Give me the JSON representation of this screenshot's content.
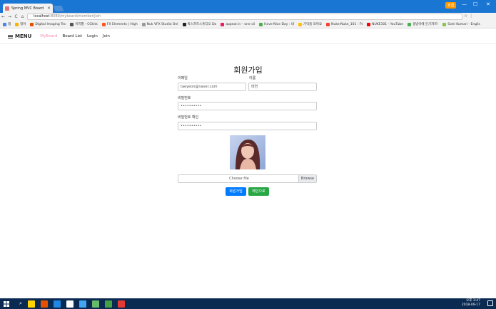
{
  "browser": {
    "tab_title": "Spring MVC Board",
    "tab_close": "×",
    "url_host": "localhost",
    "url_path": ":8080/myboard/member/join",
    "window_controls": [
      "—",
      "☐",
      "✕"
    ],
    "profile_label": "죠셉",
    "nav_icons": [
      "←",
      "→",
      "C",
      "⌂"
    ],
    "addr_icons": "☆ ⋮",
    "bookmarks": [
      {
        "label": "앱",
        "color": "#4285f4"
      },
      {
        "label": "정아",
        "color": "#f4b400"
      },
      {
        "label": "Digital Imaging Tec",
        "color": "#e65100"
      },
      {
        "label": "이지툴 - CGlink",
        "color": "#555555"
      },
      {
        "label": "FX Elements | High",
        "color": "#ff5722"
      },
      {
        "label": "Nuk VFX Studio Onl",
        "color": "#999999"
      },
      {
        "label": "퀵스프트스튜디오 Do",
        "color": "#222222"
      },
      {
        "label": "appear.in – one cli",
        "color": "#e91e63"
      },
      {
        "label": "Have Nice Day : 네",
        "color": "#4caf50"
      },
      {
        "label": "기억을 쪼아요",
        "color": "#ffc107"
      },
      {
        "label": "Nuke:Nuke_101 : Ft",
        "color": "#f44336"
      },
      {
        "label": "NUKE101 - YouTube",
        "color": "#ff0000"
      },
      {
        "label": "생방이에 인기차트!",
        "color": "#4caf50"
      },
      {
        "label": "Sotri Kumari - Englis",
        "color": "#8bc34a"
      }
    ]
  },
  "site": {
    "brand": "MENU",
    "nav": [
      "MyBoard",
      "Board List",
      "Login",
      "Join"
    ],
    "active_nav": "MyBoard"
  },
  "form": {
    "title": "회원가입",
    "email_label": "이메일",
    "email_value": "taeyeon@naver.com",
    "name_label": "이름",
    "name_value": "태연",
    "password_label": "비밀번호",
    "password_value": "••••••••••",
    "password_confirm_label": "비밀번호 확인",
    "password_confirm_value": "••••••••••",
    "file_placeholder": "Choose file",
    "browse_label": "Browse",
    "submit_label": "회원가입",
    "main_label": "메인으로"
  },
  "taskbar": {
    "time": "오후 3:47",
    "date": "2018-09-17",
    "app_colors": [
      "#ffd600",
      "#e65100",
      "#1e88e5",
      "#ffffff",
      "#42a5f5",
      "#66bb6a",
      "#43a047",
      "#e53935"
    ]
  }
}
